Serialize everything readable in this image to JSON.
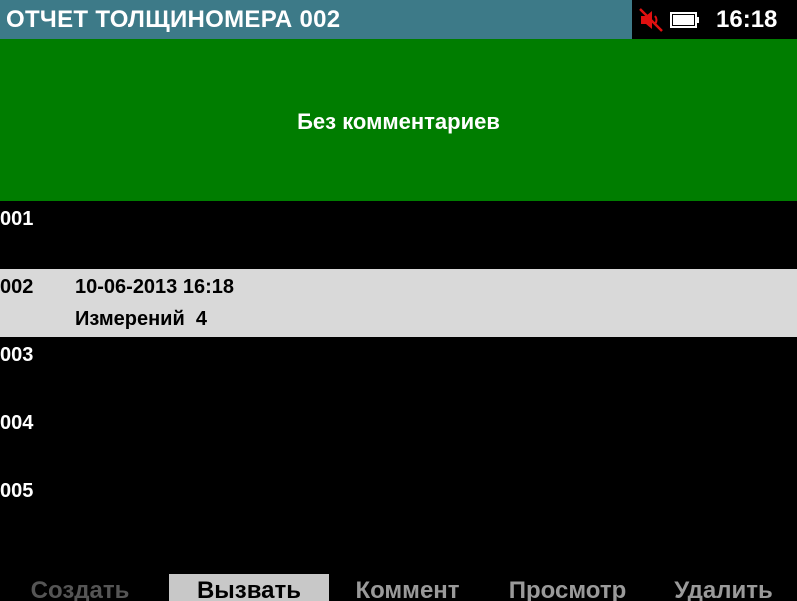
{
  "header": {
    "title": "ОТЧЕТ ТОЛЩИНОМЕРА 002",
    "clock": "16:18",
    "icons": [
      "speaker-muted-icon",
      "battery-icon"
    ]
  },
  "comment": {
    "text": "Без комментариев"
  },
  "reports": [
    {
      "num": "001",
      "date": "",
      "count": ""
    },
    {
      "num": "002",
      "date": "10-06-2013 16:18",
      "count": "Измерений  4",
      "selected": true
    },
    {
      "num": "003",
      "date": "",
      "count": ""
    },
    {
      "num": "004",
      "date": "",
      "count": ""
    },
    {
      "num": "005",
      "date": "",
      "count": ""
    }
  ],
  "softkeys": [
    {
      "label": "Создать",
      "state": "disabled"
    },
    {
      "label": "Вызвать",
      "state": "active"
    },
    {
      "label": "Коммент",
      "state": "normal"
    },
    {
      "label": "Просмотр",
      "state": "normal"
    },
    {
      "label": "Удалить",
      "state": "normal"
    }
  ],
  "colors": {
    "titlebar": "#3d7a88",
    "comment_bg": "#007d00",
    "selected_row": "#d9d9d9",
    "mute_icon": "#e01010"
  }
}
